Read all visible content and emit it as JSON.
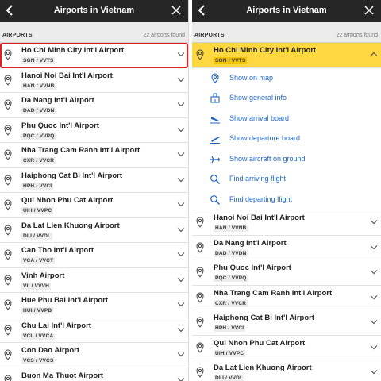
{
  "title": "Airports in Vietnam",
  "section_label": "AIRPORTS",
  "count_label": "22 airports found",
  "colors": {
    "header": "#262626",
    "highlight": "#ffd740",
    "link": "#1e64c8",
    "selection": "#e01f1f"
  },
  "left_airports": [
    {
      "name": "Ho Chi Minh City Int'l Airport",
      "code": "SGN / VVTS"
    },
    {
      "name": "Hanoi Noi Bai Int'l Airport",
      "code": "HAN / VVNB"
    },
    {
      "name": "Da Nang Int'l Airport",
      "code": "DAD / VVDN"
    },
    {
      "name": "Phu Quoc Int'l Airport",
      "code": "PQC / VVPQ"
    },
    {
      "name": "Nha Trang Cam Ranh Int'l Airport",
      "code": "CXR / VVCR"
    },
    {
      "name": "Haiphong Cat Bi Int'l Airport",
      "code": "HPH / VVCI"
    },
    {
      "name": "Qui Nhon Phu Cat Airport",
      "code": "UIH / VVPC"
    },
    {
      "name": "Da Lat Lien Khuong Airport",
      "code": "DLI / VVDL"
    },
    {
      "name": "Can Tho Int'l Airport",
      "code": "VCA / VVCT"
    },
    {
      "name": "Vinh Airport",
      "code": "VII / VVVH"
    },
    {
      "name": "Hue Phu Bai Int'l Airport",
      "code": "HUI / VVPB"
    },
    {
      "name": "Chu Lai Int'l Airport",
      "code": "VCL / VVCA"
    },
    {
      "name": "Con Dao Airport",
      "code": "VCS / VVCS"
    },
    {
      "name": "Buon Ma Thuot Airport",
      "code": "BMV / VVBM"
    }
  ],
  "right_airports": [
    {
      "name": "Ho Chi Minh City Int'l Airport",
      "code": "SGN / VVTS"
    },
    {
      "name": "Hanoi Noi Bai Int'l Airport",
      "code": "HAN / VVNB"
    },
    {
      "name": "Da Nang Int'l Airport",
      "code": "DAD / VVDN"
    },
    {
      "name": "Phu Quoc Int'l Airport",
      "code": "PQC / VVPQ"
    },
    {
      "name": "Nha Trang Cam Ranh Int'l Airport",
      "code": "CXR / VVCR"
    },
    {
      "name": "Haiphong Cat Bi Int'l Airport",
      "code": "HPH / VVCI"
    },
    {
      "name": "Qui Nhon Phu Cat Airport",
      "code": "UIH / VVPC"
    },
    {
      "name": "Da Lat Lien Khuong Airport",
      "code": "DLI / VVDL"
    }
  ],
  "menu": [
    {
      "label": "Show on map",
      "icon": "map-pin-icon"
    },
    {
      "label": "Show general info",
      "icon": "building-icon"
    },
    {
      "label": "Show arrival board",
      "icon": "arrival-plane-icon"
    },
    {
      "label": "Show departure board",
      "icon": "departure-plane-icon"
    },
    {
      "label": "Show aircraft on ground",
      "icon": "aircraft-ground-icon"
    },
    {
      "label": "Find arriving flight",
      "icon": "search-icon"
    },
    {
      "label": "Find departing flight",
      "icon": "search-icon"
    }
  ]
}
